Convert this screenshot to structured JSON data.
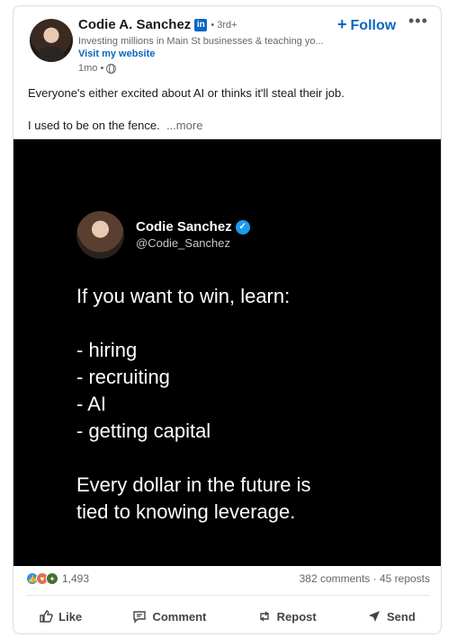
{
  "header": {
    "name": "Codie A. Sanchez",
    "badge": "in",
    "degree": "• 3rd+",
    "headline": "Investing millions in Main St businesses & teaching yo...",
    "website": "Visit my website",
    "time": "1mo •",
    "follow_label": "Follow",
    "follow_icon": "+",
    "more_icon": "•••"
  },
  "post": {
    "line1": "Everyone's either excited about AI or thinks it'll steal their job.",
    "line2": "I used to be on the fence.",
    "see_more": "...more"
  },
  "tweet": {
    "name": "Codie Sanchez",
    "verified_icon": "✓",
    "handle": "@Codie_Sanchez",
    "intro": "If you want to win, learn:",
    "items": [
      "- hiring",
      "- recruiting",
      "- AI",
      "- getting capital"
    ],
    "closing1": "Every dollar in the future is",
    "closing2": "tied to knowing leverage."
  },
  "social": {
    "reaction_count": "1,493",
    "comments_reposts": "382 comments · 45 reposts"
  },
  "actions": {
    "like": "Like",
    "comment": "Comment",
    "repost": "Repost",
    "send": "Send"
  },
  "icons": {
    "like": "thumbs-up-icon",
    "comment": "comment-icon",
    "repost": "repost-icon",
    "send": "send-icon"
  },
  "colors": {
    "accent": "#0a66c2",
    "verified": "#1d9bf0",
    "media_bg": "#000000"
  }
}
